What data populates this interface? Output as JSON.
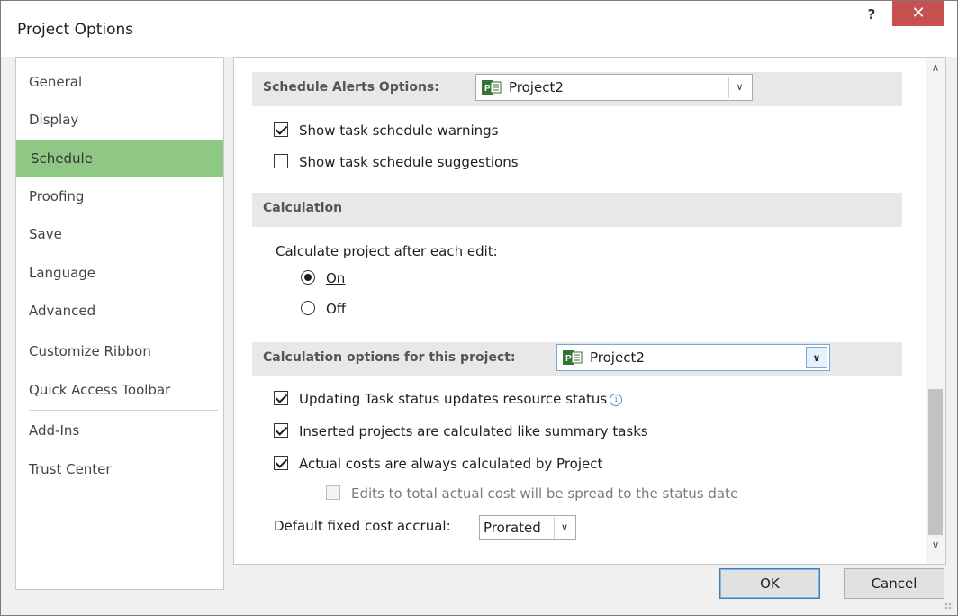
{
  "window": {
    "title": "Project Options",
    "help_label": "?",
    "close_label": "✕"
  },
  "nav": {
    "items": [
      {
        "label": "General"
      },
      {
        "label": "Display"
      },
      {
        "label": "Schedule",
        "selected": true
      },
      {
        "label": "Proofing"
      },
      {
        "label": "Save"
      },
      {
        "label": "Language"
      },
      {
        "label": "Advanced"
      },
      {
        "label": "Customize Ribbon"
      },
      {
        "label": "Quick Access Toolbar"
      },
      {
        "label": "Add-Ins"
      },
      {
        "label": "Trust Center"
      }
    ]
  },
  "schedule_alerts": {
    "section_label": "Schedule Alerts Options:",
    "project_value": "Project2",
    "show_warnings_label": "Show task schedule warnings",
    "show_warnings_checked": true,
    "show_suggestions_label": "Show task schedule suggestions",
    "show_suggestions_checked": false
  },
  "calculation": {
    "section_label": "Calculation",
    "prompt": "Calculate project after each edit:",
    "on_label": "On",
    "off_label": "Off",
    "selected": "On"
  },
  "calc_options": {
    "section_label": "Calculation options for this project:",
    "project_value": "Project2",
    "updating_status_label": "Updating Task status updates resource status",
    "inserted_projects_label": "Inserted projects are calculated like summary tasks",
    "actual_costs_label": "Actual costs are always calculated by Project",
    "edits_total_label": "Edits to total actual cost will be spread to the status date",
    "default_accrual_label": "Default fixed cost accrual:",
    "default_accrual_value": "Prorated"
  },
  "buttons": {
    "ok": "OK",
    "cancel": "Cancel"
  },
  "icons": {
    "project_file": "project-file-icon",
    "info": "info-icon",
    "dropdown": "chevron-down-icon"
  },
  "colors": {
    "selected_nav": "#8fc885",
    "close_button": "#c75050",
    "section_bar": "#e8e8e8"
  }
}
